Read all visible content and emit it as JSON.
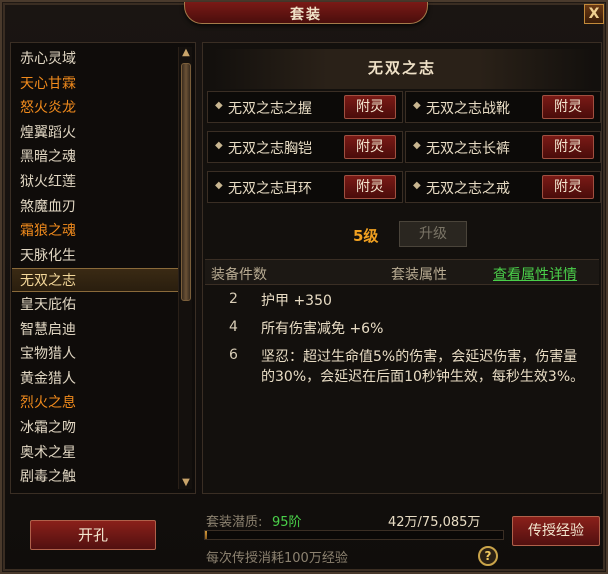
{
  "window": {
    "title": "套装",
    "close_symbol": "X"
  },
  "set_list": {
    "items": [
      {
        "label": "赤心灵域",
        "color": "normal"
      },
      {
        "label": "天心甘霖",
        "color": "orange"
      },
      {
        "label": "怒火炎龙",
        "color": "orange"
      },
      {
        "label": "煌翼蹈火",
        "color": "normal"
      },
      {
        "label": "黑暗之魂",
        "color": "normal"
      },
      {
        "label": "狱火红莲",
        "color": "normal"
      },
      {
        "label": "煞魔血刃",
        "color": "normal"
      },
      {
        "label": "霜狼之魂",
        "color": "orange"
      },
      {
        "label": "天脉化生",
        "color": "normal"
      },
      {
        "label": "无双之志",
        "color": "selected"
      },
      {
        "label": "皇天庇佑",
        "color": "normal"
      },
      {
        "label": "智慧启迪",
        "color": "normal"
      },
      {
        "label": "宝物猎人",
        "color": "normal"
      },
      {
        "label": "黄金猎人",
        "color": "normal"
      },
      {
        "label": "烈火之息",
        "color": "orange"
      },
      {
        "label": "冰霜之吻",
        "color": "normal"
      },
      {
        "label": "奥术之星",
        "color": "normal"
      },
      {
        "label": "剧毒之触",
        "color": "normal"
      }
    ],
    "scroll_up": "▲",
    "scroll_down": "▼"
  },
  "detail": {
    "set_name": "无双之志",
    "pieces": [
      {
        "name": "无双之志之握",
        "button": "附灵"
      },
      {
        "name": "无双之志战靴",
        "button": "附灵"
      },
      {
        "name": "无双之志胸铠",
        "button": "附灵"
      },
      {
        "name": "无双之志长裤",
        "button": "附灵"
      },
      {
        "name": "无双之志耳环",
        "button": "附灵"
      },
      {
        "name": "无双之志之戒",
        "button": "附灵"
      }
    ],
    "level_text": "5级",
    "upgrade_label": "升级",
    "header": {
      "count_col": "装备件数",
      "attr_col": "套装属性",
      "details_link": "查看属性详情"
    },
    "bonuses": [
      {
        "count": "2",
        "desc": "护甲  +350"
      },
      {
        "count": "4",
        "desc": "所有伤害减免  +6%"
      },
      {
        "count": "6",
        "desc": "坚忍：超过生命值5%的伤害，会延迟伤害，伤害量的30%，会延迟在后面10秒钟生效，每秒生效3%。"
      }
    ]
  },
  "bottom": {
    "kaikong_label": "开孔",
    "potential_label": "套装潜质:",
    "potential_value": "95阶",
    "exp_text": "42万/75,085万",
    "exp_progress": 0.0056,
    "cost_text": "每次传授消耗100万经验",
    "help_symbol": "?",
    "transfer_label": "传授经验"
  },
  "colors": {
    "orange_text": "#f08a1c",
    "green_text": "#4ad04a",
    "level_gold": "#f0a020",
    "button_red": "#7a1a16"
  }
}
